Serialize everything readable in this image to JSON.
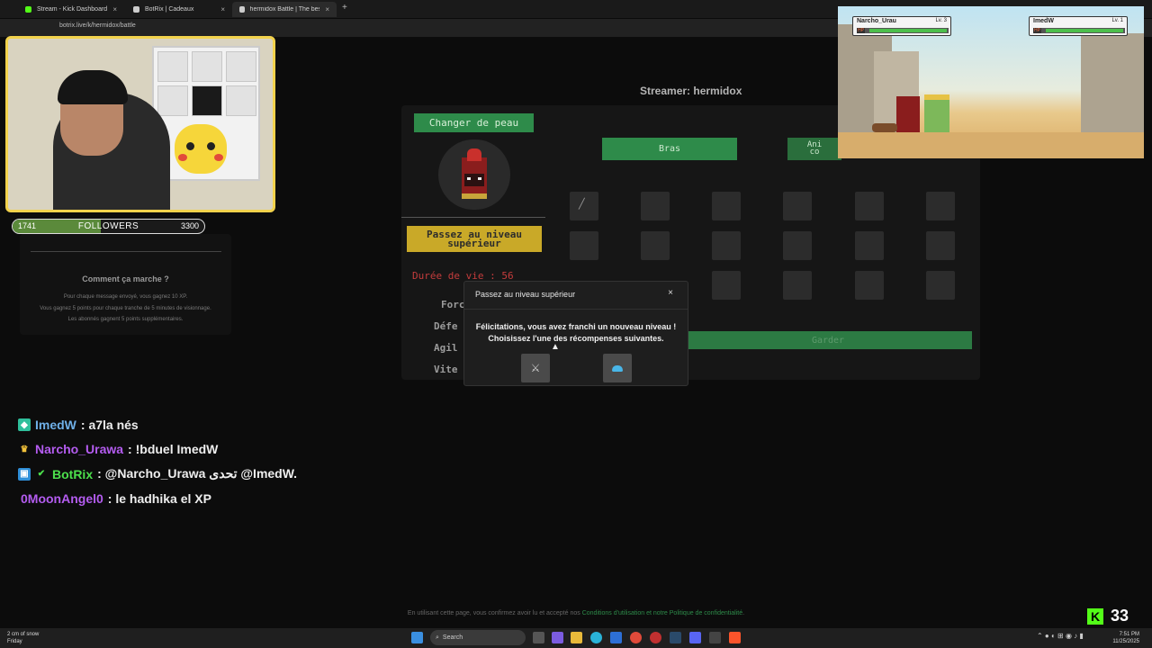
{
  "browser": {
    "tabs": [
      {
        "title": "Stream - Kick Dashboard",
        "color": "#53fc18"
      },
      {
        "title": "BotRix | Cadeaux",
        "color": "#cccccc"
      },
      {
        "title": "hermidox Battle | The best Chat",
        "color": "#cccccc"
      }
    ],
    "url": "botrix.live/k/hermidox/battle"
  },
  "followers": {
    "low": "1741",
    "label": "FOLLOWERS",
    "high": "3300",
    "progress": 0.46
  },
  "how": {
    "title": "Comment ça marche ?",
    "lines": [
      "Pour chaque message envoyé, vous gagnez 10 XP.",
      "Vous gagnez 5 points pour chaque tranche de 5 minutes de visionnage.",
      "Les abonnés gagnent 5 points supplémentaires."
    ]
  },
  "streamer_label": "Streamer: hermidox",
  "battle": {
    "change_skin": "Changer de peau",
    "level_up_line1": "Passez au niveau",
    "level_up_line2": "supérieur",
    "life": "Durée de vie : 56",
    "stats": [
      "Forc",
      "Défe",
      "Agil",
      "Vite"
    ],
    "arms_tab": "Bras",
    "anim_line1": "Ani",
    "anim_line2": "co",
    "keep": "Garder"
  },
  "modal": {
    "title": "Passez au niveau supérieur",
    "close": "×",
    "line1": "Félicitations, vous avez franchi un nouveau niveau !",
    "line2": "Choisissez l'une des récompenses suivantes."
  },
  "game": {
    "player1": {
      "name": "Narcho_Urau",
      "level": "Lv. 3",
      "hp": 0.98
    },
    "player2": {
      "name": "ImedW",
      "level": "Lv. 1",
      "hp": 0.98
    },
    "hp_label": "HP"
  },
  "chat": [
    {
      "user": "ImedW",
      "color": "#6fb0e8",
      "text": ": a7la nés",
      "badge_color": "#2fbf9b"
    },
    {
      "user": "Narcho_Urawa",
      "color": "#b45cf0",
      "text": ": !bduel ImedW",
      "badge_color": "#f2c23a"
    },
    {
      "user": "BotRix",
      "color": "#4ce04c",
      "text": ": @Narcho_Urawa تحدى @ImedW.",
      "badge_color": "#2f8fd8"
    },
    {
      "user": "0MoonAngel0",
      "color": "#b45cf0",
      "text": ": le hadhika el XP",
      "badge_color": ""
    }
  ],
  "footer": {
    "prefix": "En utilisant cette page, vous confirmez avoir lu et accepté nos",
    "terms": "Conditions d'utilisation et notre Politique de confidentialité",
    "suffix": "."
  },
  "kick": {
    "logo": "K",
    "count": "33"
  },
  "taskbar": {
    "weather1": "2 cm of snow",
    "weather2": "Friday",
    "search": "Search",
    "time": "7:51 PM",
    "date": "11/25/2025"
  }
}
